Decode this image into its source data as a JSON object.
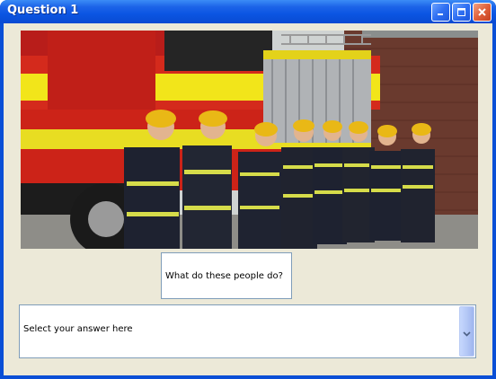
{
  "window": {
    "title": "Question 1"
  },
  "question": {
    "text": "What do these people do?"
  },
  "answer": {
    "value": "Select your answer here"
  },
  "icons": {
    "minimize": "minimize-icon",
    "maximize": "maximize-icon",
    "close": "close-icon",
    "dropdown": "chevron-down-icon"
  },
  "colors": {
    "titlebar": "#0a4fd6",
    "client_bg": "#ece9d8",
    "close_button": "#e0613b"
  }
}
